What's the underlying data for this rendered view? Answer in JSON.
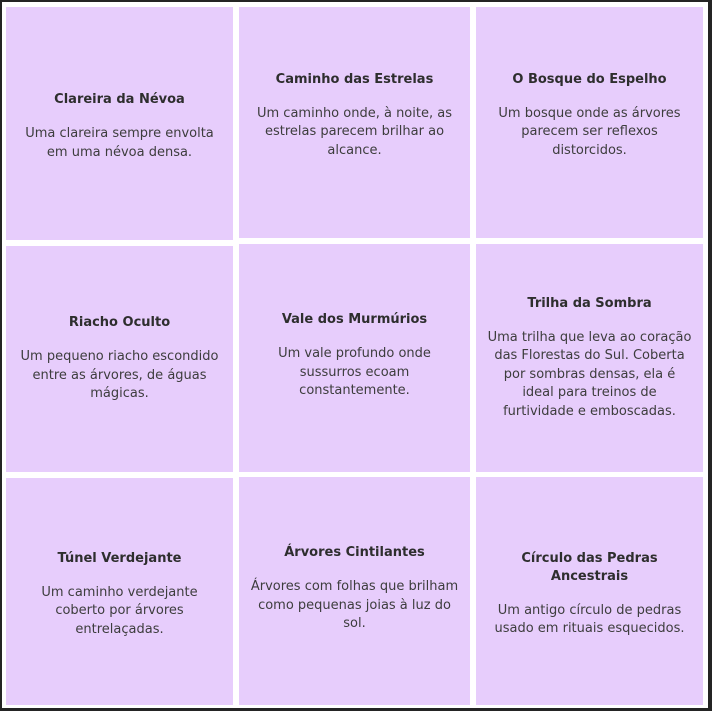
{
  "cards": [
    {
      "title": "Clareira da Névoa",
      "description": "Uma clareira sempre envolta em uma névoa densa."
    },
    {
      "title": "Caminho das Estrelas",
      "description": "Um caminho onde, à noite, as estrelas parecem brilhar ao alcance."
    },
    {
      "title": "O Bosque do Espelho",
      "description": "Um bosque onde as árvores parecem ser reflexos distorcidos."
    },
    {
      "title": "Riacho Oculto",
      "description": "Um pequeno riacho escondido entre as árvores, de águas mágicas."
    },
    {
      "title": "Vale dos Murmúrios",
      "description": "Um vale profundo onde sussurros ecoam constantemente."
    },
    {
      "title": "Trilha da Sombra",
      "description": "Uma trilha que leva ao coração das Florestas do Sul. Coberta por sombras densas, ela é ideal para treinos de furtividade e emboscadas."
    },
    {
      "title": "Túnel Verdejante",
      "description": "Um caminho verdejante coberto por árvores entrelaçadas."
    },
    {
      "title": "Árvores Cintilantes",
      "description": "Árvores com folhas que brilham como pequenas joias à luz do sol."
    },
    {
      "title": "Círculo das Pedras Ancestrais",
      "description": "Um antigo círculo de pedras usado em rituais esquecidos."
    }
  ],
  "colors": {
    "card_background": "#e7cdfc",
    "board_background": "#ffffff",
    "frame": "#242424"
  }
}
